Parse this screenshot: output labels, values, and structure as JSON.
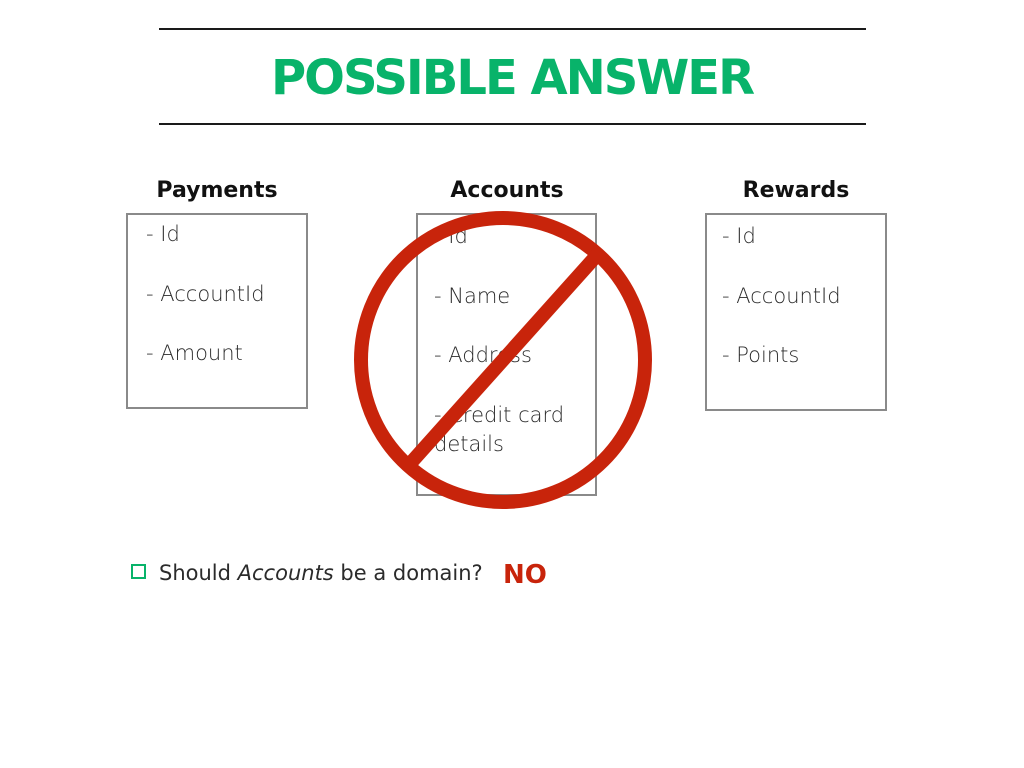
{
  "slide": {
    "title": "POSSIBLE ANSWER",
    "colors": {
      "title": "#08b36a",
      "no_sign": "#c8240b",
      "answer": "#c8240b",
      "bullet": "#08b36a"
    }
  },
  "columns": {
    "payments": {
      "heading": "Payments",
      "fields": [
        "- Id",
        "- AccountId",
        "- Amount"
      ]
    },
    "accounts": {
      "heading": "Accounts",
      "fields": [
        "- Id",
        "- Name",
        "- Address",
        "- Credit card",
        "details"
      ]
    },
    "rewards": {
      "heading": "Rewards",
      "fields": [
        "- Id",
        "- AccountId",
        "- Points"
      ]
    }
  },
  "question": {
    "prefix": "Should ",
    "emphasis": "Accounts",
    "suffix": " be a domain?",
    "answer": "NO"
  },
  "icons": {
    "crossed_out": "prohibition-sign-icon",
    "bullet": "checkbox-bullet-icon"
  }
}
